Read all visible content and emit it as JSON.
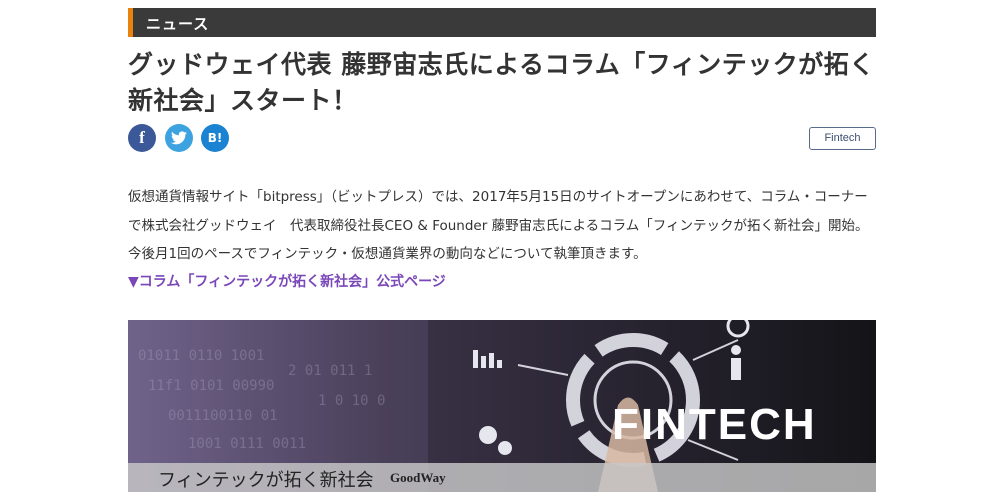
{
  "section": {
    "label": "ニュース"
  },
  "article": {
    "title": "グッドウェイ代表 藤野宙志氏によるコラム「フィンテックが拓く新社会」スタート！",
    "tag": "Fintech",
    "body": "仮想通貨情報サイト「bitpress」（ビットプレス）では、2017年5月15日のサイトオープンにあわせて、コラム・コーナーで株式会社グッドウェイ　代表取締役社長CEO & Founder 藤野宙志氏によるコラム「フィンテックが拓く新社会」開始。今後月1回のペースでフィンテック・仮想通貨業界の動向などについて執筆頂きます。",
    "link": "▼コラム「フィンテックが拓く新社会」公式ページ"
  },
  "share": {
    "facebook": "f",
    "twitter": "twitter-bird-icon",
    "hatena": "B!"
  },
  "banner": {
    "word": "FINTECH",
    "caption": "フィンテックが拓く新社会",
    "brand": "GoodWay"
  },
  "colors": {
    "section_bg": "#3a3a3a",
    "section_accent": "#e8820c",
    "link": "#7a47b8",
    "facebook": "#3b5998",
    "twitter": "#3da3e0",
    "hatena": "#1b83d1"
  }
}
